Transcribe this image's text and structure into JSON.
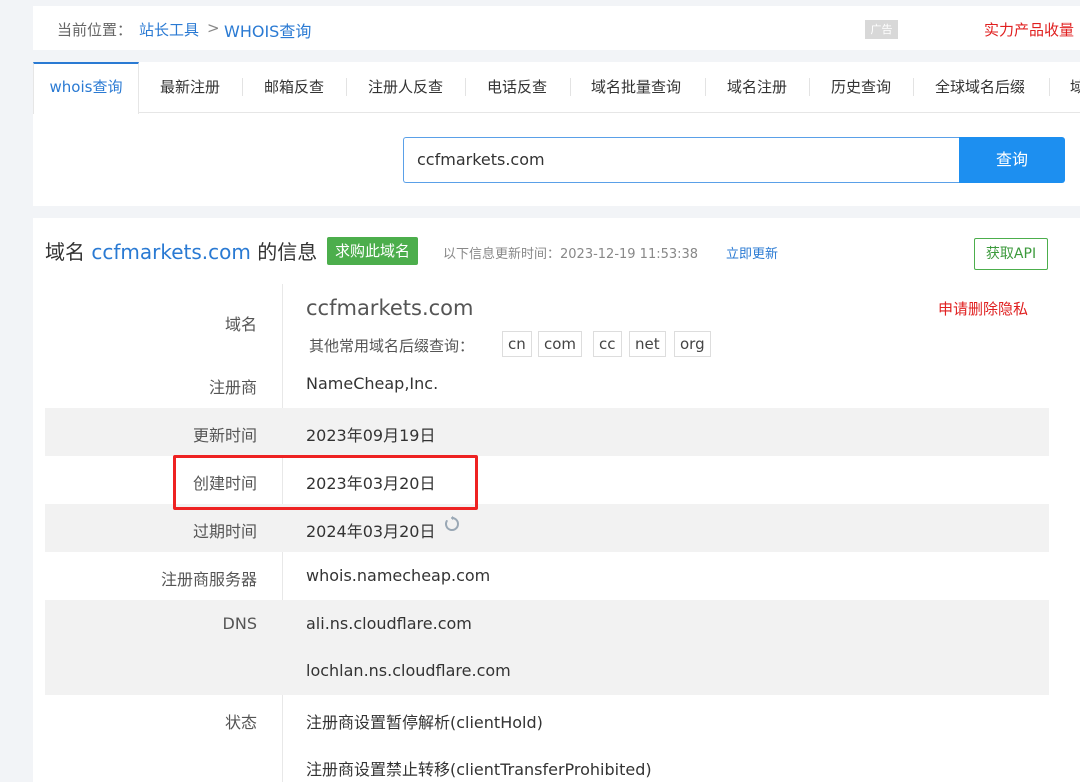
{
  "breadcrumb": {
    "prefix": "当前位置：",
    "items": [
      "站长工具",
      "WHOIS查询"
    ],
    "separator": ">",
    "ad_label": "广告",
    "promo": "实力产品收量"
  },
  "tabs": [
    {
      "label": "whois查询",
      "active": true
    },
    {
      "label": "最新注册"
    },
    {
      "label": "邮箱反查"
    },
    {
      "label": "注册人反查"
    },
    {
      "label": "电话反查"
    },
    {
      "label": "域名批量查询"
    },
    {
      "label": "域名注册"
    },
    {
      "label": "历史查询"
    },
    {
      "label": "全球域名后缀"
    },
    {
      "label": "域"
    }
  ],
  "search": {
    "value": "ccfmarkets.com",
    "button": "查询"
  },
  "header": {
    "prefix": "域名",
    "domain": "ccfmarkets.com",
    "suffix": "的信息",
    "buy_badge": "求购此域名",
    "update_text": "以下信息更新时间：2023-12-19 11:53:38",
    "update_now": "立即更新",
    "api_button": "获取API"
  },
  "whois": {
    "domain_label": "域名",
    "domain_value": "ccfmarkets.com",
    "delete_privacy": "申请删除隐私",
    "suffix_query_label": "其他常用域名后缀查询：",
    "suffixes": [
      "cn",
      "com",
      "cc",
      "net",
      "org"
    ],
    "registrar_label": "注册商",
    "registrar_value": "NameCheap,Inc.",
    "updated_label": "更新时间",
    "updated_value": "2023年09月19日",
    "created_label": "创建时间",
    "created_value": "2023年03月20日",
    "expires_label": "过期时间",
    "expires_value": "2024年03月20日",
    "whois_server_label": "注册商服务器",
    "whois_server_value": "whois.namecheap.com",
    "dns_label": "DNS",
    "dns_values": [
      "ali.ns.cloudflare.com",
      "lochlan.ns.cloudflare.com"
    ],
    "status_label": "状态",
    "status_values": [
      "注册商设置暂停解析(clientHold)",
      "注册商设置禁止转移(clientTransferProhibited)"
    ]
  },
  "colors": {
    "link": "#2a7ad3",
    "primary_button": "#1d8ff0",
    "badge_green": "#4cae4c",
    "highlight_red": "#e22222"
  }
}
